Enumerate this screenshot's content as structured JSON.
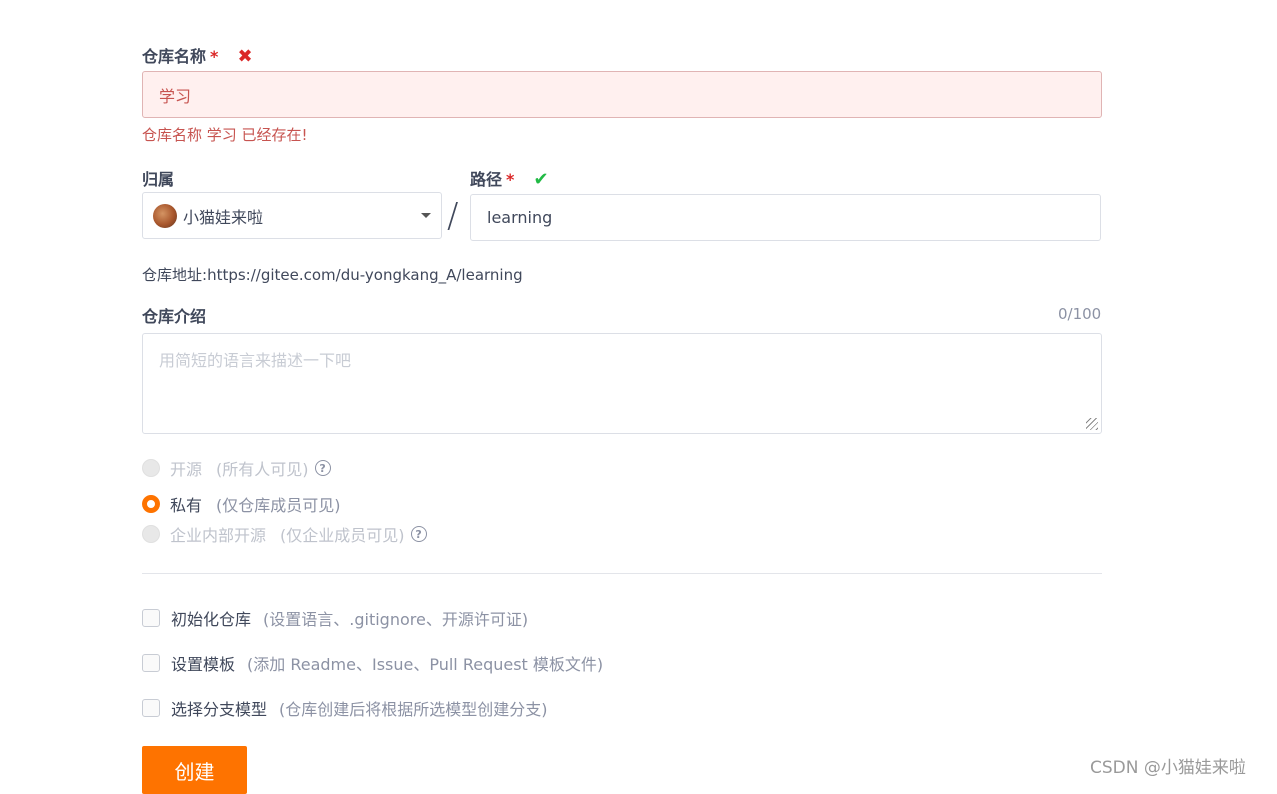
{
  "repo_name": {
    "label": "仓库名称",
    "required_mark": "*",
    "value": "学习",
    "error": "仓库名称 学习 已经存在!"
  },
  "owner": {
    "label": "归属",
    "value": "小猫娃来啦"
  },
  "separator": "/",
  "path": {
    "label": "路径",
    "required_mark": "*",
    "value": "learning"
  },
  "repo_url": {
    "label": "仓库地址:",
    "value": "https://gitee.com/du-yongkang_A/learning"
  },
  "description": {
    "label": "仓库介绍",
    "counter": "0/100",
    "placeholder": "用简短的语言来描述一下吧"
  },
  "visibility": {
    "options": [
      {
        "label": "开源",
        "hint": "(所有人可见)",
        "state": "disabled",
        "has_help": true
      },
      {
        "label": "私有",
        "hint": "(仅仓库成员可见)",
        "state": "selected",
        "has_help": false
      },
      {
        "label": "企业内部开源",
        "hint": "(仅企业成员可见)",
        "state": "disabled",
        "has_help": true
      }
    ]
  },
  "options": {
    "init_repo": {
      "label": "初始化仓库",
      "hint": "(设置语言、.gitignore、开源许可证)",
      "checked": false
    },
    "templates": {
      "label": "设置模板",
      "hint": "(添加 Readme、Issue、Pull Request 模板文件)",
      "checked": false
    },
    "branch_model": {
      "label": "选择分支模型",
      "hint": "(仓库创建后将根据所选模型创建分支)",
      "checked": false
    }
  },
  "submit_label": "创建",
  "watermark": "CSDN @小猫娃来啦",
  "colors": {
    "accent": "#fe7300",
    "error": "#db2828",
    "success": "#21ba45"
  }
}
